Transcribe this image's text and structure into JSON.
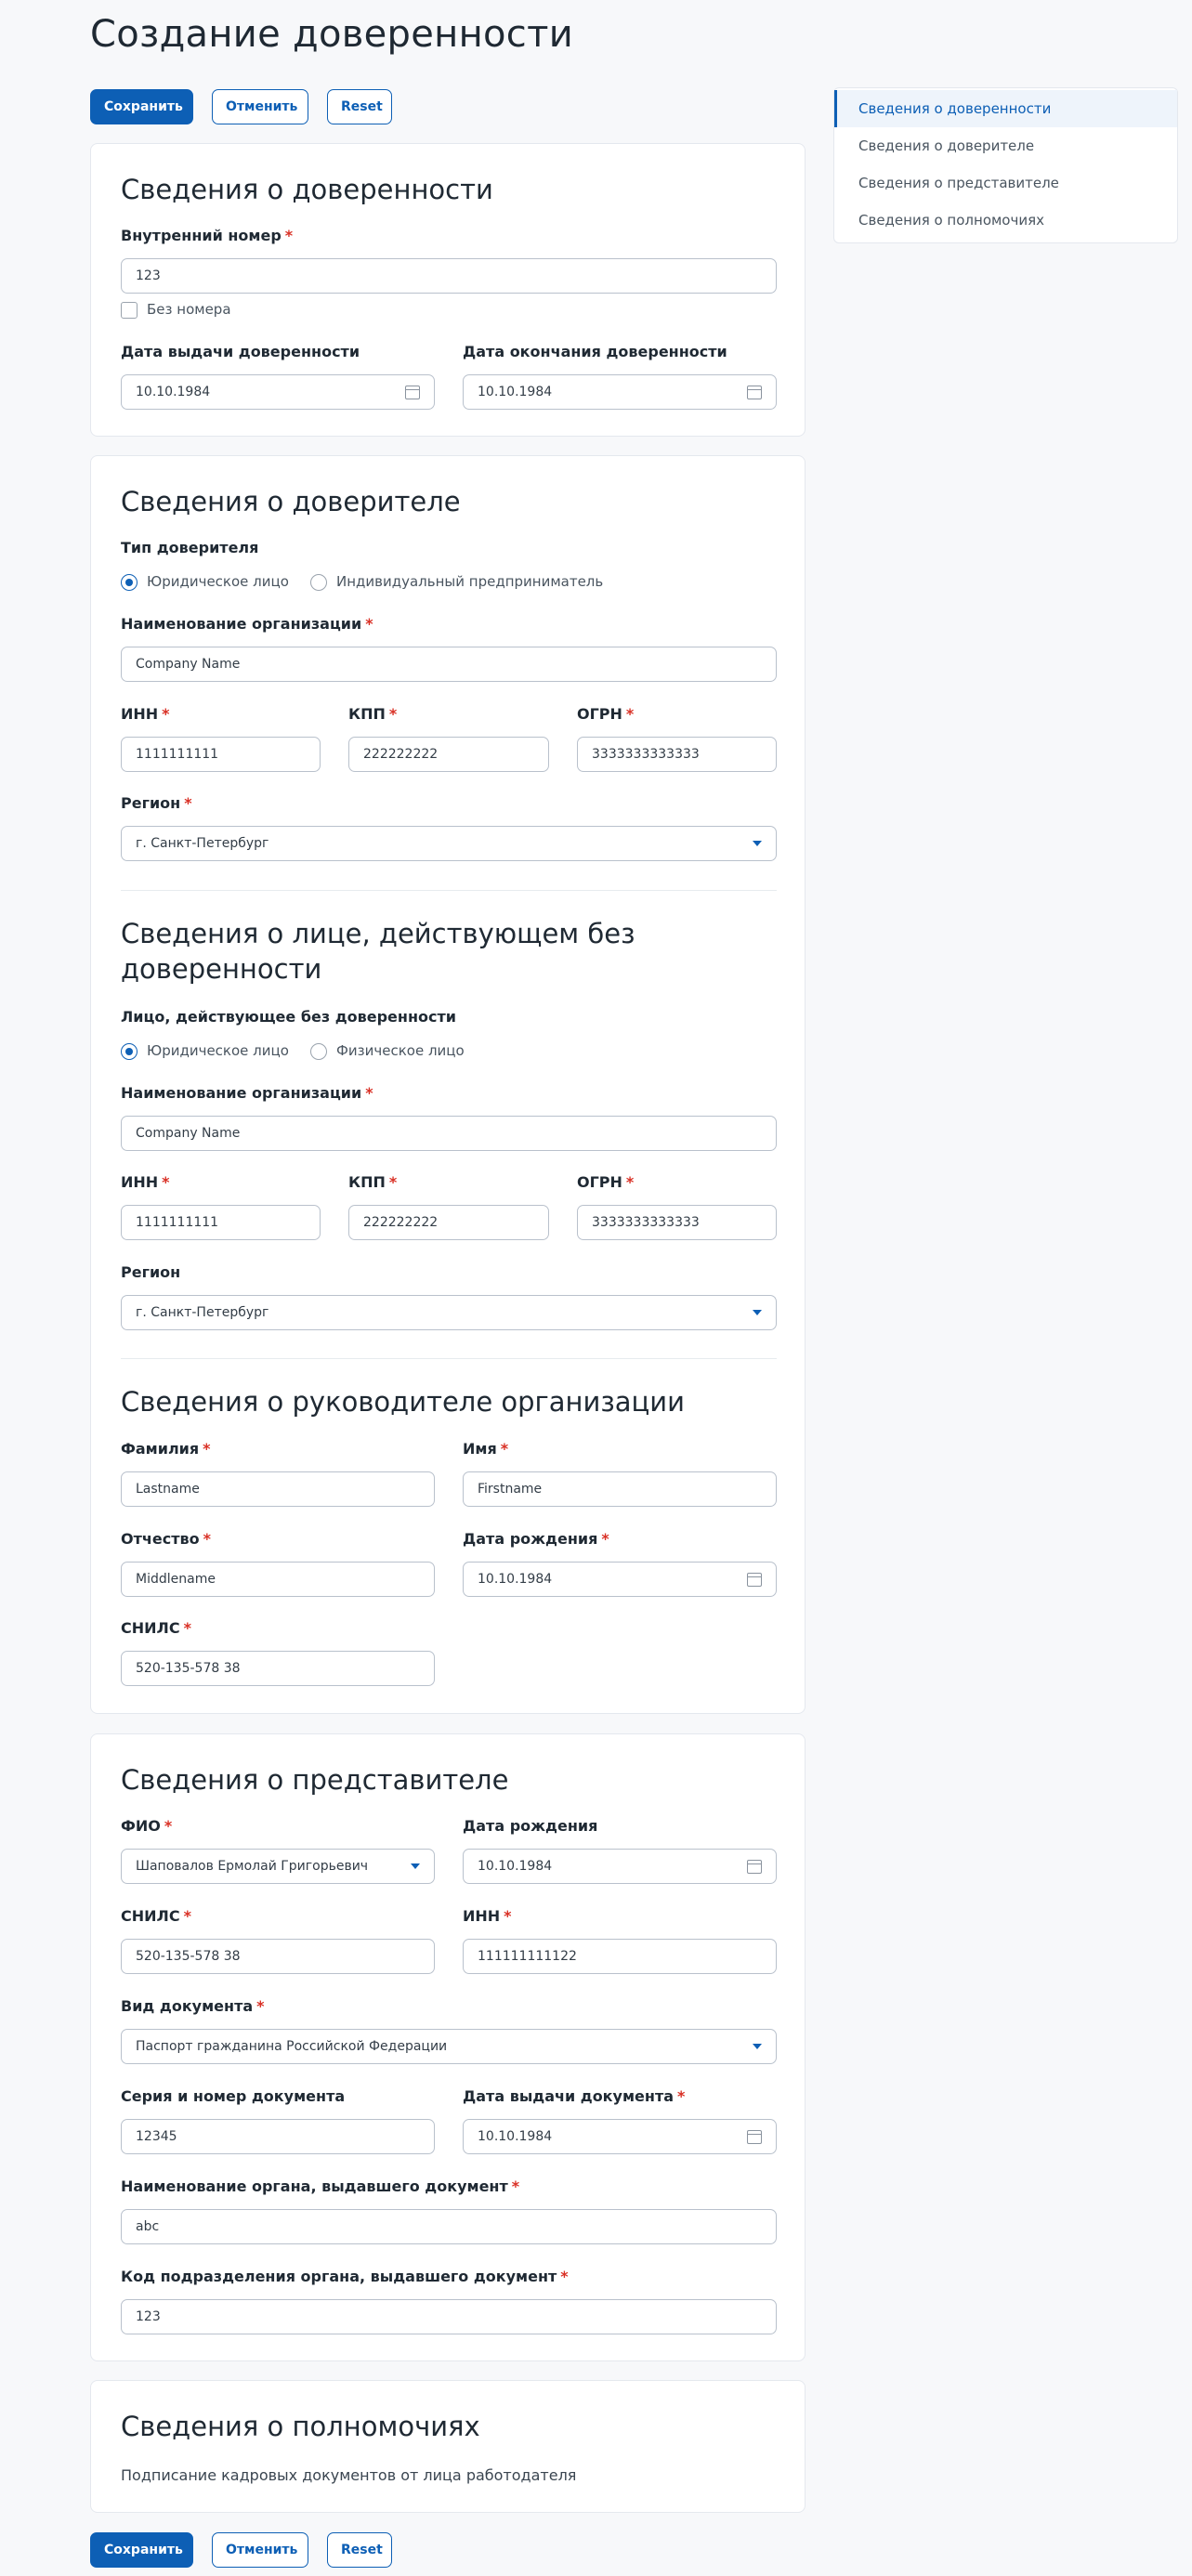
{
  "page": {
    "title": "Создание доверенности"
  },
  "actions": {
    "save": "Сохранить",
    "cancel": "Отменить",
    "reset": "Reset"
  },
  "toc": {
    "items": [
      "Сведения о доверенности",
      "Сведения о доверителе",
      "Сведения о представителе",
      "Сведения о полномочиях"
    ],
    "active_index": 0
  },
  "colors": {
    "accent": "#0d5fb5",
    "required": "#d93025"
  },
  "required_mark": "*",
  "poa": {
    "title": "Сведения о доверенности",
    "number_label": "Внутренний номер",
    "number_value": "123",
    "no_number_label": "Без номера",
    "no_number_checked": false,
    "issue_date_label": "Дата выдачи доверенности",
    "issue_date_value": "10.10.1984",
    "end_date_label": "Дата окончания доверенности",
    "end_date_value": "10.10.1984"
  },
  "principal": {
    "title": "Сведения о доверителе",
    "type_label": "Тип доверителя",
    "type_options": [
      "Юридическое лицо",
      "Индивидуальный предприниматель"
    ],
    "type_selected": 0,
    "org_name_label": "Наименование организации",
    "org_name_value": "Company Name",
    "inn_label": "ИНН",
    "inn_value": "1111111111",
    "kpp_label": "КПП",
    "kpp_value": "222222222",
    "ogrn_label": "ОГРН",
    "ogrn_value": "3333333333333",
    "region_label": "Регион",
    "region_value": "г. Санкт-Петербург"
  },
  "acting": {
    "title": "Сведения о лице, действующем без доверенности",
    "type_label": "Лицо, действующее без доверенности",
    "type_options": [
      "Юридическое лицо",
      "Физическое лицо"
    ],
    "type_selected": 0,
    "org_name_label": "Наименование организации",
    "org_name_value": "Company Name",
    "inn_label": "ИНН",
    "inn_value": "1111111111",
    "kpp_label": "КПП",
    "kpp_value": "222222222",
    "ogrn_label": "ОГРН",
    "ogrn_value": "3333333333333",
    "region_label": "Регион",
    "region_value": "г. Санкт-Петербург"
  },
  "head": {
    "title": "Сведения о руководителе организации",
    "lastname_label": "Фамилия",
    "lastname_value": "Lastname",
    "firstname_label": "Имя",
    "firstname_value": "Firstname",
    "middlename_label": "Отчество",
    "middlename_value": "Middlename",
    "birth_label": "Дата рождения",
    "birth_value": "10.10.1984",
    "snils_label": "СНИЛС",
    "snils_value": "520-135-578 38"
  },
  "rep": {
    "title": "Сведения о представителе",
    "fio_label": "ФИО",
    "fio_value": "Шаповалов Ермолай Григорьевич",
    "birth_label": "Дата рождения",
    "birth_value": "10.10.1984",
    "snils_label": "СНИЛС",
    "snils_value": "520-135-578 38",
    "inn_label": "ИНН",
    "inn_value": "111111111122",
    "doc_type_label": "Вид документа",
    "doc_type_value": "Паспорт гражданина Российской Федерации",
    "doc_number_label": "Серия и номер документа",
    "doc_number_value": "12345",
    "doc_date_label": "Дата выдачи документа",
    "doc_date_value": "10.10.1984",
    "issuer_label": "Наименование органа, выдавшего документ",
    "issuer_value": "abc",
    "issuer_code_label": "Код подразделения органа, выдавшего документ",
    "issuer_code_value": "123"
  },
  "powers": {
    "title": "Сведения о полномочиях",
    "text": "Подписание кадровых документов от лица работодателя"
  }
}
